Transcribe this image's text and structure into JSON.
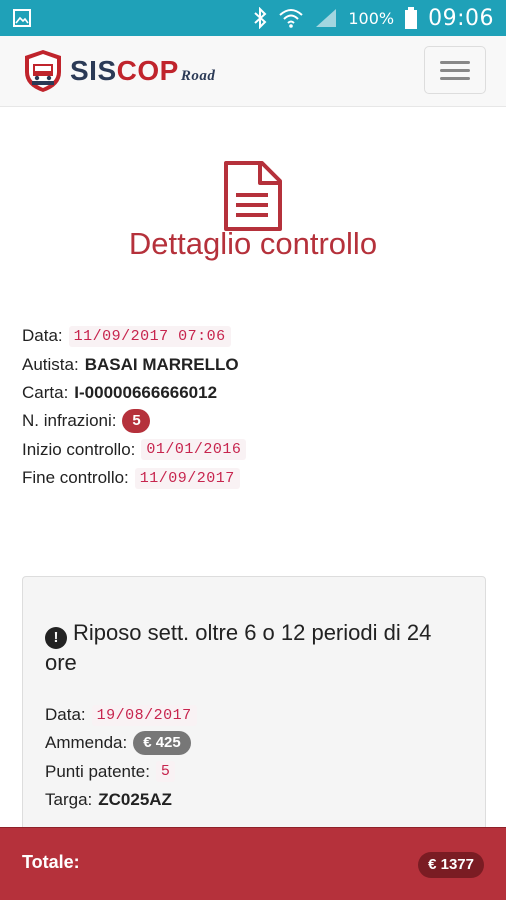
{
  "status_bar": {
    "battery_percent": "100%",
    "time": "09:06",
    "icons": [
      "image-icon",
      "bluetooth-icon",
      "wifi-icon",
      "signal-icon",
      "battery-icon"
    ],
    "color": "#1fa1b8"
  },
  "navbar": {
    "logo_sis": "SIS",
    "logo_cop": "COP",
    "logo_road": "Road",
    "menu_icon": "hamburger-menu-icon"
  },
  "header": {
    "icon": "document-icon",
    "title": "Dettaglio controllo"
  },
  "details": {
    "data_label": "Data:",
    "data_value": "11/09/2017 07:06",
    "autista_label": "Autista:",
    "autista_value": "BASAI MARRELLO",
    "carta_label": "Carta:",
    "carta_value": "I-00000666666012",
    "infrazioni_label": "N. infrazioni:",
    "infrazioni_value": "5",
    "inizio_label": "Inizio controllo:",
    "inizio_value": "01/01/2016",
    "fine_label": "Fine controllo:",
    "fine_value": "11/09/2017"
  },
  "infraction": {
    "icon": "exclamation-circle-icon",
    "title": "Riposo sett. oltre 6 o 12 periodi di 24 ore",
    "data_label": "Data:",
    "data_value": "19/08/2017",
    "ammenda_label": "Ammenda:",
    "ammenda_value": "€ 425",
    "punti_label": "Punti patente:",
    "punti_value": "5",
    "targa_label": "Targa:",
    "targa_value": "ZC025AZ"
  },
  "footer": {
    "total_label": "Totale:",
    "total_value": "€ 1377"
  },
  "colors": {
    "accent": "#b5313b",
    "code_text": "#c7254e",
    "code_bg": "#f9f2f4",
    "logo_navy": "#2b3a56",
    "logo_red": "#c0242c"
  }
}
